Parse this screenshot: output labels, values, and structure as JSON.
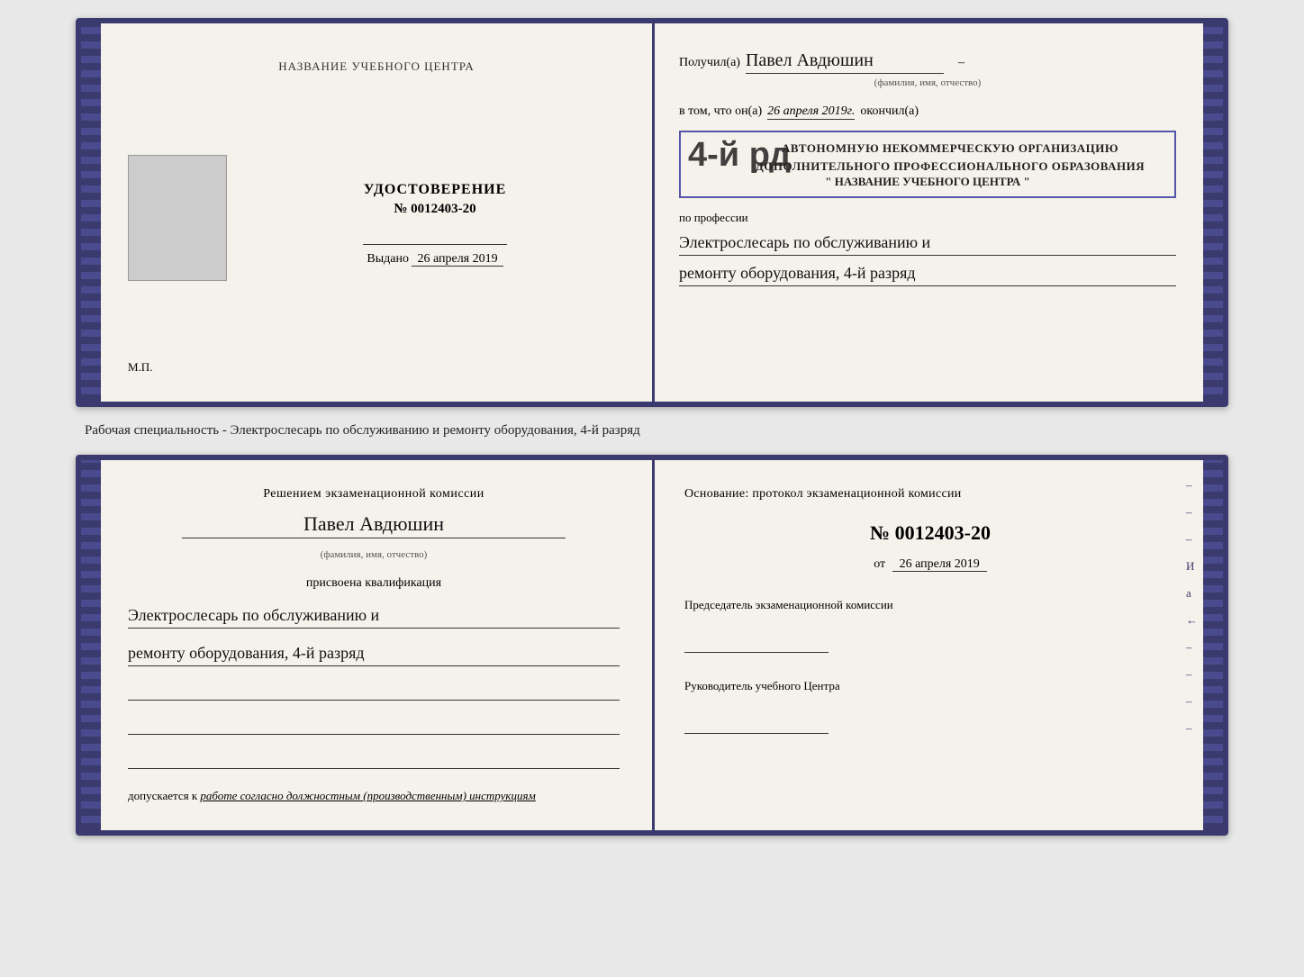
{
  "top_book": {
    "left": {
      "heading": "НАЗВАНИЕ УЧЕБНОГО ЦЕНТРА",
      "title": "УДОСТОВЕРЕНИЕ",
      "number": "№ 0012403-20",
      "vydano_label": "Выдано",
      "vydano_date": "26 апреля 2019",
      "mp_label": "М.П."
    },
    "right": {
      "poluchil_label": "Получил(а)",
      "name": "Павел Авдюшин",
      "fio_subtitle": "(фамилия, имя, отчество)",
      "vtom_label": "в том, что он(а)",
      "date_italic": "26 апреля 2019г.",
      "okoncil_label": "окончил(а)",
      "rank_big": "4-й рд",
      "stamp_line1": "АВТОНОМНУЮ НЕКОММЕРЧЕСКУЮ ОРГАНИЗАЦИЮ",
      "stamp_line2": "ДОПОЛНИТЕЛЬНОГО ПРОФЕССИОНАЛЬНОГО ОБРАЗОВАНИЯ",
      "stamp_quote": "\" НАЗВАНИЕ УЧЕБНОГО ЦЕНТРА \"",
      "po_professii_label": "по профессии",
      "profession_line1": "Электрослесарь по обслуживанию и",
      "profession_line2": "ремонту оборудования, 4-й разряд"
    }
  },
  "middle_text": "Рабочая специальность - Электрослесарь по обслуживанию и ремонту оборудования, 4-й разряд",
  "bottom_book": {
    "left": {
      "resheniem": "Решением экзаменационной  комиссии",
      "name": "Павел Авдюшин",
      "fio_subtitle": "(фамилия, имя, отчество)",
      "prisvoena": "присвоена квалификация",
      "qualification_line1": "Электрослесарь по обслуживанию и",
      "qualification_line2": "ремонту оборудования, 4-й разряд",
      "dopuskaetsya": "допускается к",
      "dopusk_italic": "работе согласно должностным (производственным) инструкциям"
    },
    "right": {
      "osnovanie": "Основание: протокол экзаменационной  комиссии",
      "number_label": "№  0012403-20",
      "ot_label": "от",
      "ot_date": "26 апреля 2019",
      "predsedatel_label": "Председатель экзаменационной комиссии",
      "rukovoditel_label": "Руководитель учебного Центра"
    }
  },
  "side_chars": [
    "И",
    "а",
    "←",
    "–",
    "–",
    "–",
    "–",
    "–"
  ]
}
